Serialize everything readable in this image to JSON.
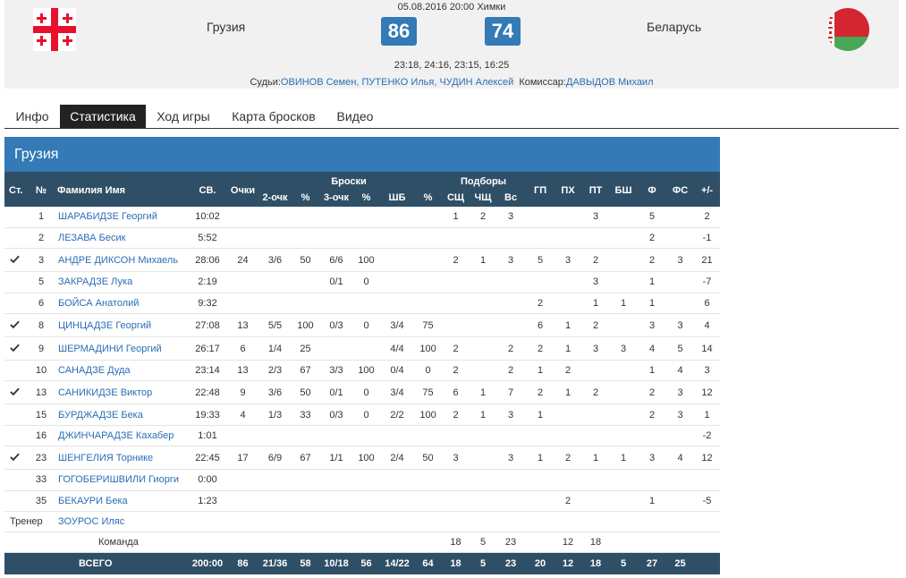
{
  "match": {
    "datetime_venue": "05.08.2016 20:00 Химки",
    "home": {
      "name": "Грузия",
      "score": "86",
      "flag_icon": "georgia-flag-icon"
    },
    "away": {
      "name": "Беларусь",
      "score": "74",
      "flag_icon": "belarus-flag-icon"
    },
    "periods": "23:18, 24:16, 23:15, 16:25",
    "referees_label": "Судьи:",
    "referees": "ОВИНОВ Семен, ПУТЕНКО Илья, ЧУДИН Алексей",
    "commissioner_label": "Комиссар:",
    "commissioner": "ДАВЫДОВ Михаил"
  },
  "tabs": [
    {
      "label": "Инфо",
      "active": false
    },
    {
      "label": "Статистика",
      "active": true
    },
    {
      "label": "Ход игры",
      "active": false
    },
    {
      "label": "Карта бросков",
      "active": false
    },
    {
      "label": "Видео",
      "active": false
    }
  ],
  "table": {
    "team_title": "Грузия",
    "group_headers": {
      "shots": "Броски",
      "rebounds": "Подборы"
    },
    "headers": {
      "start": "Ст.",
      "num": "№",
      "name": "Фамилия Имя",
      "time": "СВ.",
      "pts": "Очки",
      "two": "2-очк",
      "two_pct": "%",
      "three": "3-очк",
      "three_pct": "%",
      "ft": "ШБ",
      "ft_pct": "%",
      "oreb": "СЩ",
      "dreb": "ЧЩ",
      "reb": "Вс",
      "ast": "ГП",
      "stl": "ПХ",
      "to": "ПТ",
      "blk": "БШ",
      "pf": "Ф",
      "fd": "ФС",
      "pm": "+/-"
    },
    "rows": [
      {
        "start": false,
        "num": "1",
        "name": "ШАРАБИДЗЕ Георгий",
        "time": "10:02",
        "pts": "",
        "two": "",
        "two_pct": "",
        "three": "",
        "three_pct": "",
        "ft": "",
        "ft_pct": "",
        "oreb": "1",
        "dreb": "2",
        "reb": "3",
        "ast": "",
        "stl": "",
        "to": "3",
        "blk": "",
        "pf": "5",
        "fd": "",
        "pm": "2"
      },
      {
        "start": false,
        "num": "2",
        "name": "ЛЕЗАВА Бесик",
        "time": "5:52",
        "pts": "",
        "two": "",
        "two_pct": "",
        "three": "",
        "three_pct": "",
        "ft": "",
        "ft_pct": "",
        "oreb": "",
        "dreb": "",
        "reb": "",
        "ast": "",
        "stl": "",
        "to": "",
        "blk": "",
        "pf": "2",
        "fd": "",
        "pm": "-1"
      },
      {
        "start": true,
        "num": "3",
        "name": "АНДРЕ ДИКСОН Михаель",
        "time": "28:06",
        "pts": "24",
        "two": "3/6",
        "two_pct": "50",
        "three": "6/6",
        "three_pct": "100",
        "ft": "",
        "ft_pct": "",
        "oreb": "2",
        "dreb": "1",
        "reb": "3",
        "ast": "5",
        "stl": "3",
        "to": "2",
        "blk": "",
        "pf": "2",
        "fd": "3",
        "pm": "21"
      },
      {
        "start": false,
        "num": "5",
        "name": "ЗАКРАДЗЕ Лука",
        "time": "2:19",
        "pts": "",
        "two": "",
        "two_pct": "",
        "three": "0/1",
        "three_pct": "0",
        "ft": "",
        "ft_pct": "",
        "oreb": "",
        "dreb": "",
        "reb": "",
        "ast": "",
        "stl": "",
        "to": "3",
        "blk": "",
        "pf": "1",
        "fd": "",
        "pm": "-7"
      },
      {
        "start": false,
        "num": "6",
        "name": "БОЙСА Анатолий",
        "time": "9:32",
        "pts": "",
        "two": "",
        "two_pct": "",
        "three": "",
        "three_pct": "",
        "ft": "",
        "ft_pct": "",
        "oreb": "",
        "dreb": "",
        "reb": "",
        "ast": "2",
        "stl": "",
        "to": "1",
        "blk": "1",
        "pf": "1",
        "fd": "",
        "pm": "6"
      },
      {
        "start": true,
        "num": "8",
        "name": "ЦИНЦАДЗЕ Георгий",
        "time": "27:08",
        "pts": "13",
        "two": "5/5",
        "two_pct": "100",
        "three": "0/3",
        "three_pct": "0",
        "ft": "3/4",
        "ft_pct": "75",
        "oreb": "",
        "dreb": "",
        "reb": "",
        "ast": "6",
        "stl": "1",
        "to": "2",
        "blk": "",
        "pf": "3",
        "fd": "3",
        "pm": "4"
      },
      {
        "start": true,
        "num": "9",
        "name": "ШЕРМАДИНИ Георгий",
        "time": "26:17",
        "pts": "6",
        "two": "1/4",
        "two_pct": "25",
        "three": "",
        "three_pct": "",
        "ft": "4/4",
        "ft_pct": "100",
        "oreb": "2",
        "dreb": "",
        "reb": "2",
        "ast": "2",
        "stl": "1",
        "to": "3",
        "blk": "3",
        "pf": "4",
        "fd": "5",
        "pm": "14"
      },
      {
        "start": false,
        "num": "10",
        "name": "САНАДЗЕ Дуда",
        "time": "23:14",
        "pts": "13",
        "two": "2/3",
        "two_pct": "67",
        "three": "3/3",
        "three_pct": "100",
        "ft": "0/4",
        "ft_pct": "0",
        "oreb": "2",
        "dreb": "",
        "reb": "2",
        "ast": "1",
        "stl": "2",
        "to": "",
        "blk": "",
        "pf": "1",
        "fd": "4",
        "pm": "3"
      },
      {
        "start": true,
        "num": "13",
        "name": "САНИКИДЗЕ Виктор",
        "time": "22:48",
        "pts": "9",
        "two": "3/6",
        "two_pct": "50",
        "three": "0/1",
        "three_pct": "0",
        "ft": "3/4",
        "ft_pct": "75",
        "oreb": "6",
        "dreb": "1",
        "reb": "7",
        "ast": "2",
        "stl": "1",
        "to": "2",
        "blk": "",
        "pf": "2",
        "fd": "3",
        "pm": "12"
      },
      {
        "start": false,
        "num": "15",
        "name": "БУРДЖАДЗЕ Бека",
        "time": "19:33",
        "pts": "4",
        "two": "1/3",
        "two_pct": "33",
        "three": "0/3",
        "three_pct": "0",
        "ft": "2/2",
        "ft_pct": "100",
        "oreb": "2",
        "dreb": "1",
        "reb": "3",
        "ast": "1",
        "stl": "",
        "to": "",
        "blk": "",
        "pf": "2",
        "fd": "3",
        "pm": "1"
      },
      {
        "start": false,
        "num": "16",
        "name": "ДЖИНЧАРАДЗЕ Кахабер",
        "time": "1:01",
        "pts": "",
        "two": "",
        "two_pct": "",
        "three": "",
        "three_pct": "",
        "ft": "",
        "ft_pct": "",
        "oreb": "",
        "dreb": "",
        "reb": "",
        "ast": "",
        "stl": "",
        "to": "",
        "blk": "",
        "pf": "",
        "fd": "",
        "pm": "-2"
      },
      {
        "start": true,
        "num": "23",
        "name": "ШЕНГЕЛИЯ Торнике",
        "time": "22:45",
        "pts": "17",
        "two": "6/9",
        "two_pct": "67",
        "three": "1/1",
        "three_pct": "100",
        "ft": "2/4",
        "ft_pct": "50",
        "oreb": "3",
        "dreb": "",
        "reb": "3",
        "ast": "1",
        "stl": "2",
        "to": "1",
        "blk": "1",
        "pf": "3",
        "fd": "4",
        "pm": "12"
      },
      {
        "start": false,
        "num": "33",
        "name": "ГОГОБЕРИШВИЛИ Гиорги",
        "time": "0:00",
        "pts": "",
        "two": "",
        "two_pct": "",
        "three": "",
        "three_pct": "",
        "ft": "",
        "ft_pct": "",
        "oreb": "",
        "dreb": "",
        "reb": "",
        "ast": "",
        "stl": "",
        "to": "",
        "blk": "",
        "pf": "",
        "fd": "",
        "pm": ""
      },
      {
        "start": false,
        "num": "35",
        "name": "БЕКАУРИ Бека",
        "time": "1:23",
        "pts": "",
        "two": "",
        "two_pct": "",
        "three": "",
        "three_pct": "",
        "ft": "",
        "ft_pct": "",
        "oreb": "",
        "dreb": "",
        "reb": "",
        "ast": "",
        "stl": "2",
        "to": "",
        "blk": "",
        "pf": "1",
        "fd": "",
        "pm": "-5"
      }
    ],
    "coach": {
      "label": "Тренер",
      "name": "ЗОУРОС Иляс"
    },
    "team_row": {
      "label": "Команда",
      "oreb": "18",
      "dreb": "5",
      "reb": "23",
      "stl": "12",
      "to": "18"
    },
    "total": {
      "label": "ВСЕГО",
      "time": "200:00",
      "pts": "86",
      "two": "21/36",
      "two_pct": "58",
      "three": "10/18",
      "three_pct": "56",
      "ft": "14/22",
      "ft_pct": "64",
      "oreb": "18",
      "dreb": "5",
      "reb": "23",
      "ast": "20",
      "stl": "12",
      "to": "18",
      "blk": "5",
      "pf": "27",
      "fd": "25",
      "pm": ""
    }
  }
}
